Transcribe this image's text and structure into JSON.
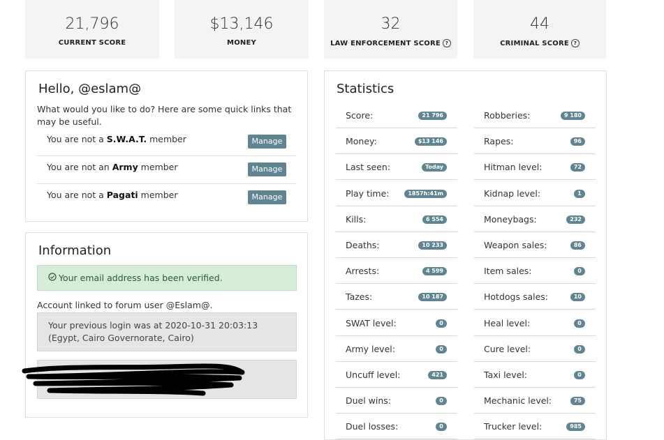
{
  "cards": [
    {
      "value": "21,796",
      "label": "CURRENT SCORE",
      "help": ""
    },
    {
      "value": "$13,146",
      "label": "MONEY",
      "help": ""
    },
    {
      "value": "32",
      "label": "LAW ENFORCEMENT SCORE",
      "help": "?"
    },
    {
      "value": "44",
      "label": "CRIMINAL SCORE",
      "help": "?"
    }
  ],
  "hello": {
    "title": "Hello, @eslam@",
    "intro": "What would you like to do? Here are some quick links that may be useful.",
    "rows": [
      {
        "pre": "You are not a ",
        "group": "S.W.A.T.",
        "post": " member",
        "button": "Manage"
      },
      {
        "pre": "You are not an ",
        "group": "Army",
        "post": " member",
        "button": "Manage"
      },
      {
        "pre": "You are not a ",
        "group": "Pagati",
        "post": " member",
        "button": "Manage"
      }
    ]
  },
  "information": {
    "title": "Information",
    "verified": "Your email address has been verified.",
    "linked": "Account linked to forum user @Eslam@.",
    "last_login": "Your previous login was at 2020-10-31 20:03:13 (Egypt, Cairo Governorate, Cairo)"
  },
  "statistics": {
    "title": "Statistics",
    "left": [
      {
        "label": "Score:",
        "value": "21 796"
      },
      {
        "label": "Money:",
        "value": "$13 146"
      },
      {
        "label": "Last seen:",
        "value": "Today"
      },
      {
        "label": "Play time:",
        "value": "1857h:41m"
      },
      {
        "label": "Kills:",
        "value": "6 554"
      },
      {
        "label": "Deaths:",
        "value": "10 233"
      },
      {
        "label": "Arrests:",
        "value": "4 599"
      },
      {
        "label": "Tazes:",
        "value": "10 187"
      },
      {
        "label": "SWAT level:",
        "value": "0"
      },
      {
        "label": "Army level:",
        "value": "0"
      },
      {
        "label": "Uncuff level:",
        "value": "421"
      },
      {
        "label": "Duel wins:",
        "value": "0"
      },
      {
        "label": "Duel losses:",
        "value": "0"
      }
    ],
    "right": [
      {
        "label": "Robberies:",
        "value": "9 180"
      },
      {
        "label": "Rapes:",
        "value": "96"
      },
      {
        "label": "Hitman level:",
        "value": "72"
      },
      {
        "label": "Kidnap level:",
        "value": "1"
      },
      {
        "label": "Moneybags:",
        "value": "232"
      },
      {
        "label": "Weapon sales:",
        "value": "86"
      },
      {
        "label": "Item sales:",
        "value": "0"
      },
      {
        "label": "Hotdogs sales:",
        "value": "10"
      },
      {
        "label": "Heal level:",
        "value": "0"
      },
      {
        "label": "Cure level:",
        "value": "0"
      },
      {
        "label": "Taxi level:",
        "value": "0"
      },
      {
        "label": "Mechanic level:",
        "value": "75"
      },
      {
        "label": "Trucker level:",
        "value": "985"
      }
    ]
  }
}
